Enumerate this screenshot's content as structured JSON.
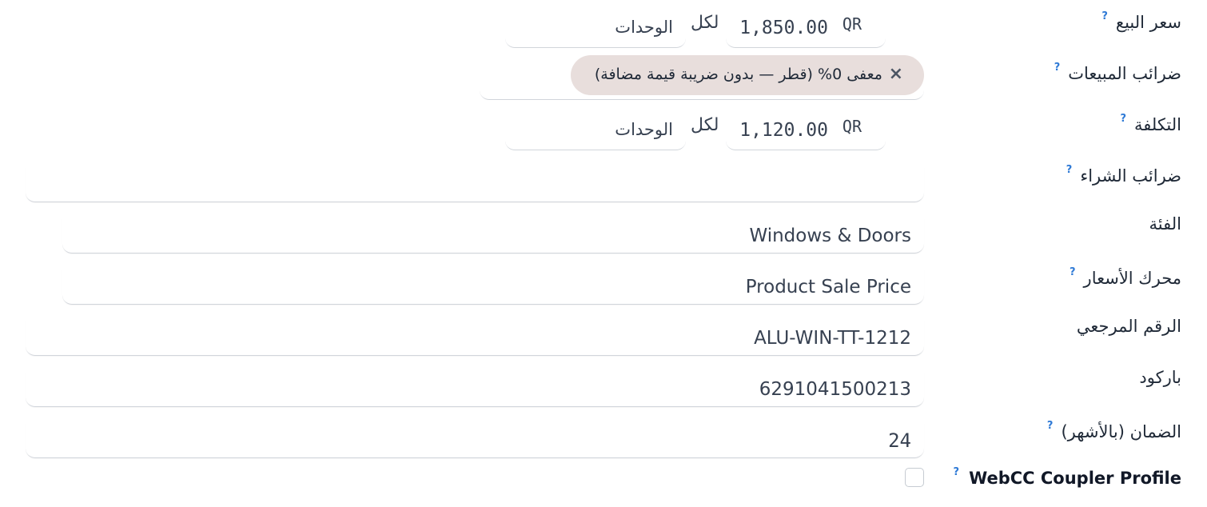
{
  "labels": {
    "sale_price": "سعر البيع",
    "sales_taxes": "ضرائب المبيعات",
    "cost": "التكلفة",
    "purchase_taxes": "ضرائب الشراء",
    "category": "الفئة",
    "pricing_engine": "محرك الأسعار",
    "reference": "الرقم المرجعي",
    "barcode": "باركود",
    "warranty": "الضمان (بالأشهر)",
    "webcc": "WebCC Coupler Profile"
  },
  "help_mark": "?",
  "sale_price": {
    "currency": "QR",
    "amount": "1,850.00",
    "per": "لكل",
    "uom": "الوحدات"
  },
  "sales_taxes": {
    "tags": [
      {
        "label": "معفى 0% (قطر — بدون ضريبة قيمة مضافة)",
        "remove": "×"
      }
    ]
  },
  "cost": {
    "currency": "QR",
    "amount": "1,120.00",
    "per": "لكل",
    "uom": "الوحدات"
  },
  "purchase_taxes": {
    "value": ""
  },
  "category": {
    "value": "Windows & Doors"
  },
  "pricing_engine": {
    "value": "Product Sale Price"
  },
  "reference": {
    "value": "ALU-WIN-TT-1212"
  },
  "barcode": {
    "value": "6291041500213"
  },
  "warranty": {
    "value": "24"
  },
  "webcc": {
    "checked": false
  },
  "colors": {
    "help": "#2f7ad6",
    "tag_bg": "#e8dedc",
    "border": "#d1d5db"
  },
  "icons": {
    "help": "question-mark",
    "tag_remove": "close-x"
  }
}
